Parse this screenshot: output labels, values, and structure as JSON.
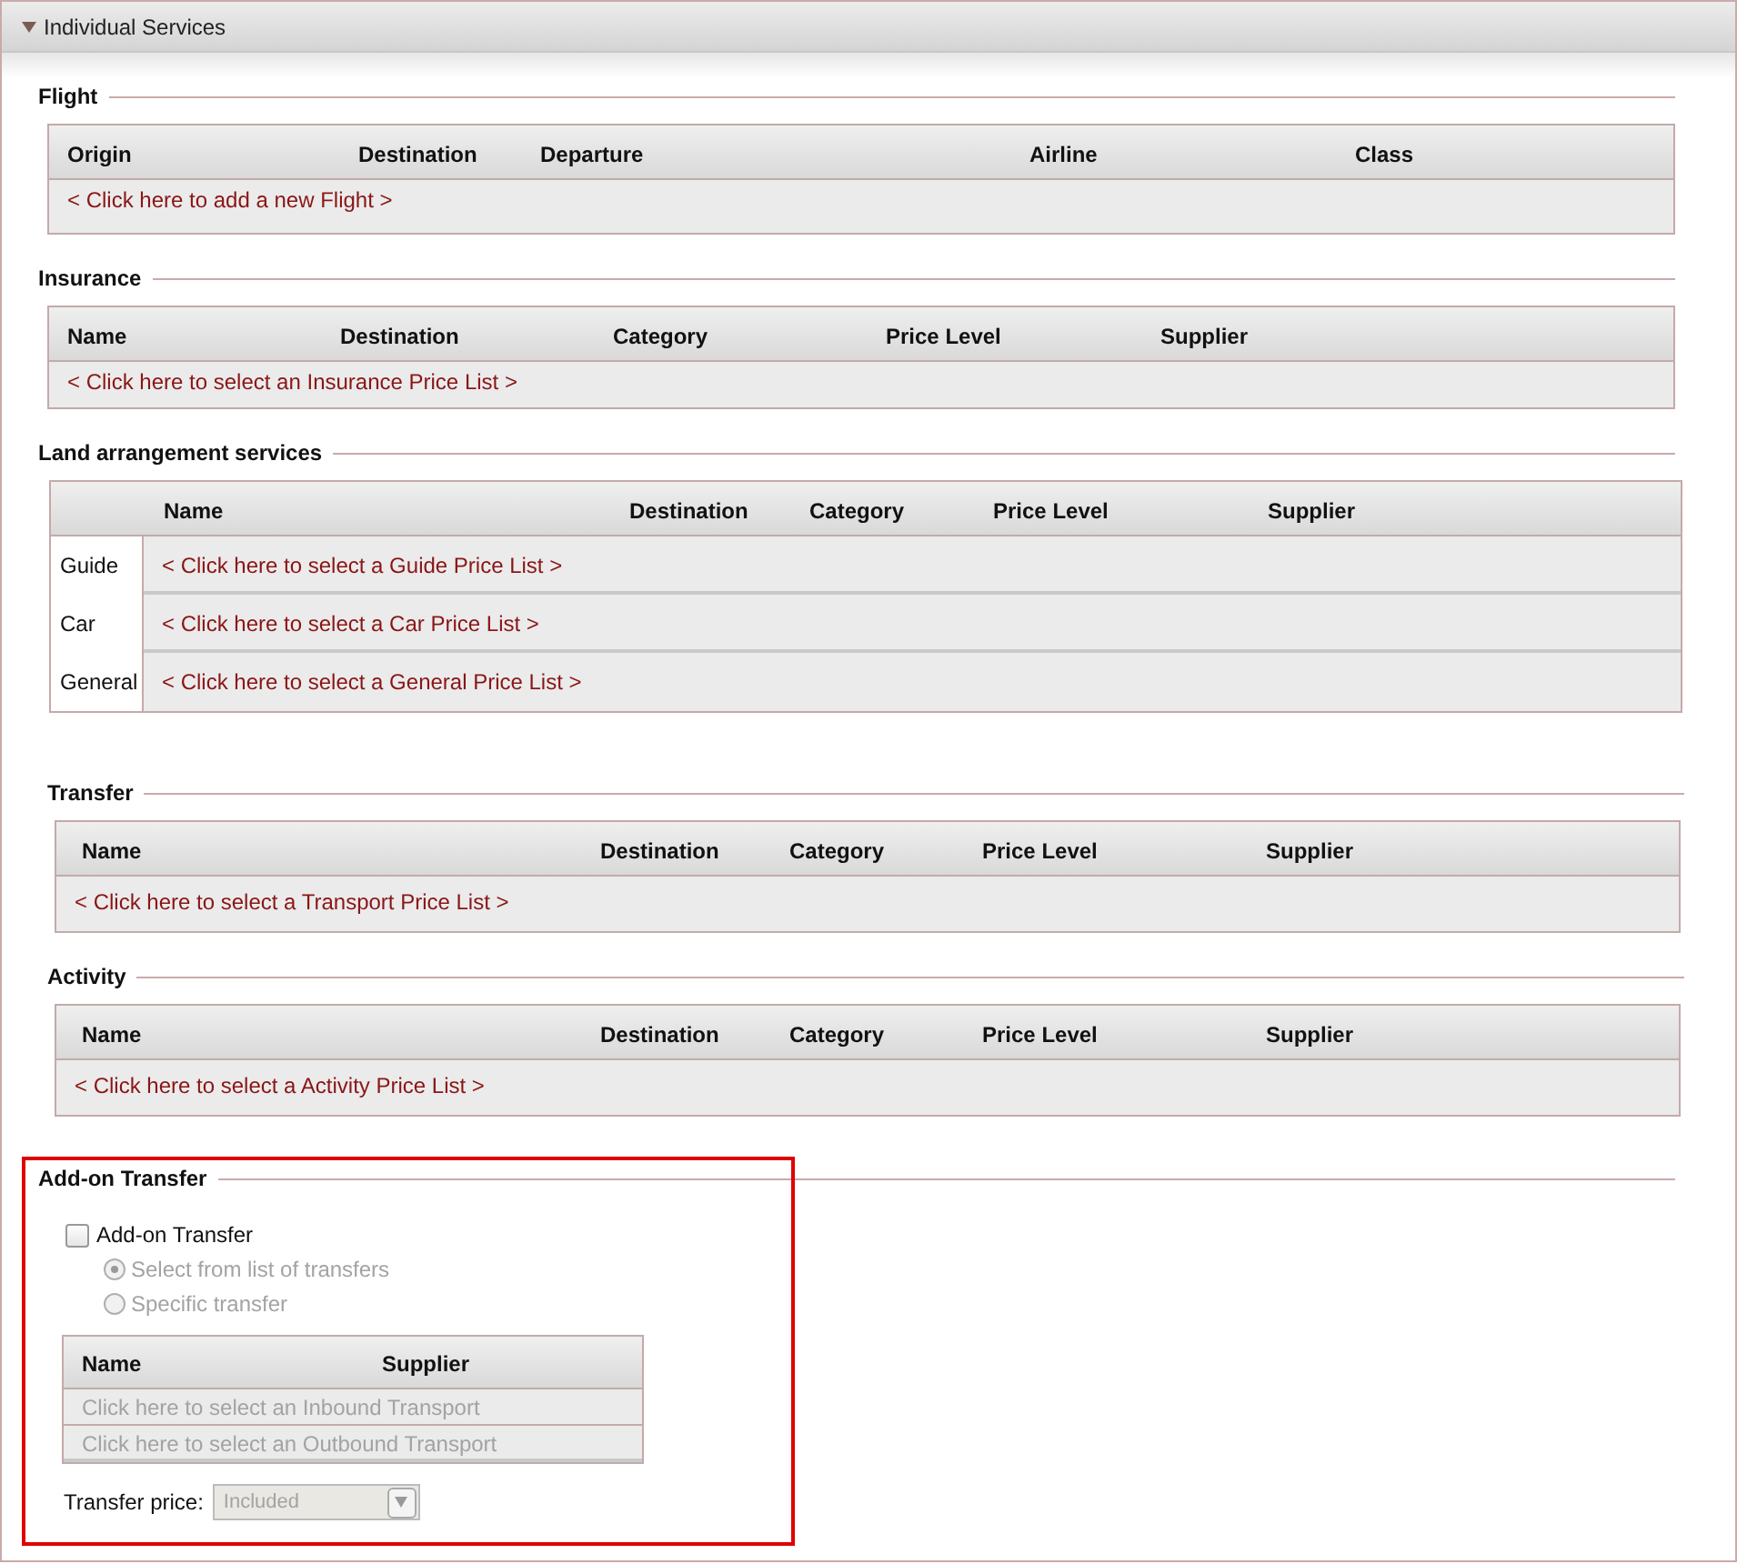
{
  "panel": {
    "title": "Individual Services",
    "expanded": true
  },
  "sections": [
    {
      "kind": "table",
      "title": "Flight",
      "columns": [
        "Origin",
        "Destination",
        "Departure",
        "Airline",
        "Class"
      ],
      "rows": [
        {
          "link": "< Click here to add a new Flight >"
        }
      ]
    },
    {
      "kind": "table",
      "title": "Insurance",
      "columns": [
        "Name",
        "Destination",
        "Category",
        "Price Level",
        "Supplier"
      ],
      "rows": [
        {
          "link": "< Click here to select an Insurance Price List >"
        }
      ]
    },
    {
      "kind": "grouped",
      "title": "Land arrangement services",
      "columns": [
        "Name",
        "Destination",
        "Category",
        "Price Level",
        "Supplier"
      ],
      "rows": [
        {
          "label": "Guide",
          "link": "< Click here to select a Guide Price List >"
        },
        {
          "label": "Car",
          "link": "< Click here to select a Car Price List >"
        },
        {
          "label": "General",
          "link": "< Click here to select a General Price List >"
        }
      ]
    },
    {
      "kind": "table",
      "title": "Transfer",
      "columns": [
        "Name",
        "Destination",
        "Category",
        "Price Level",
        "Supplier"
      ],
      "rows": [
        {
          "link": "< Click here to select a Transport Price List >"
        }
      ]
    },
    {
      "kind": "table",
      "title": "Activity",
      "columns": [
        "Name",
        "Destination",
        "Category",
        "Price Level",
        "Supplier"
      ],
      "rows": [
        {
          "link": "< Click here to select a Activity Price List >"
        }
      ]
    },
    {
      "kind": "addon",
      "title": "Add-on Transfer",
      "highlighted": true,
      "checkbox": {
        "label": "Add-on Transfer",
        "checked": false
      },
      "options": [
        {
          "label": "Select from list of transfers",
          "selected": true,
          "disabled": true
        },
        {
          "label": "Specific transfer",
          "selected": false,
          "disabled": true
        }
      ],
      "columns": [
        "Name",
        "Supplier"
      ],
      "rows": [
        {
          "link": "Click here to select an Inbound Transport",
          "disabled": true
        },
        {
          "link": "Click here to select an Outbound Transport",
          "disabled": true
        }
      ],
      "price": {
        "label": "Transfer price:",
        "value": "Included",
        "disabled": true
      }
    }
  ]
}
